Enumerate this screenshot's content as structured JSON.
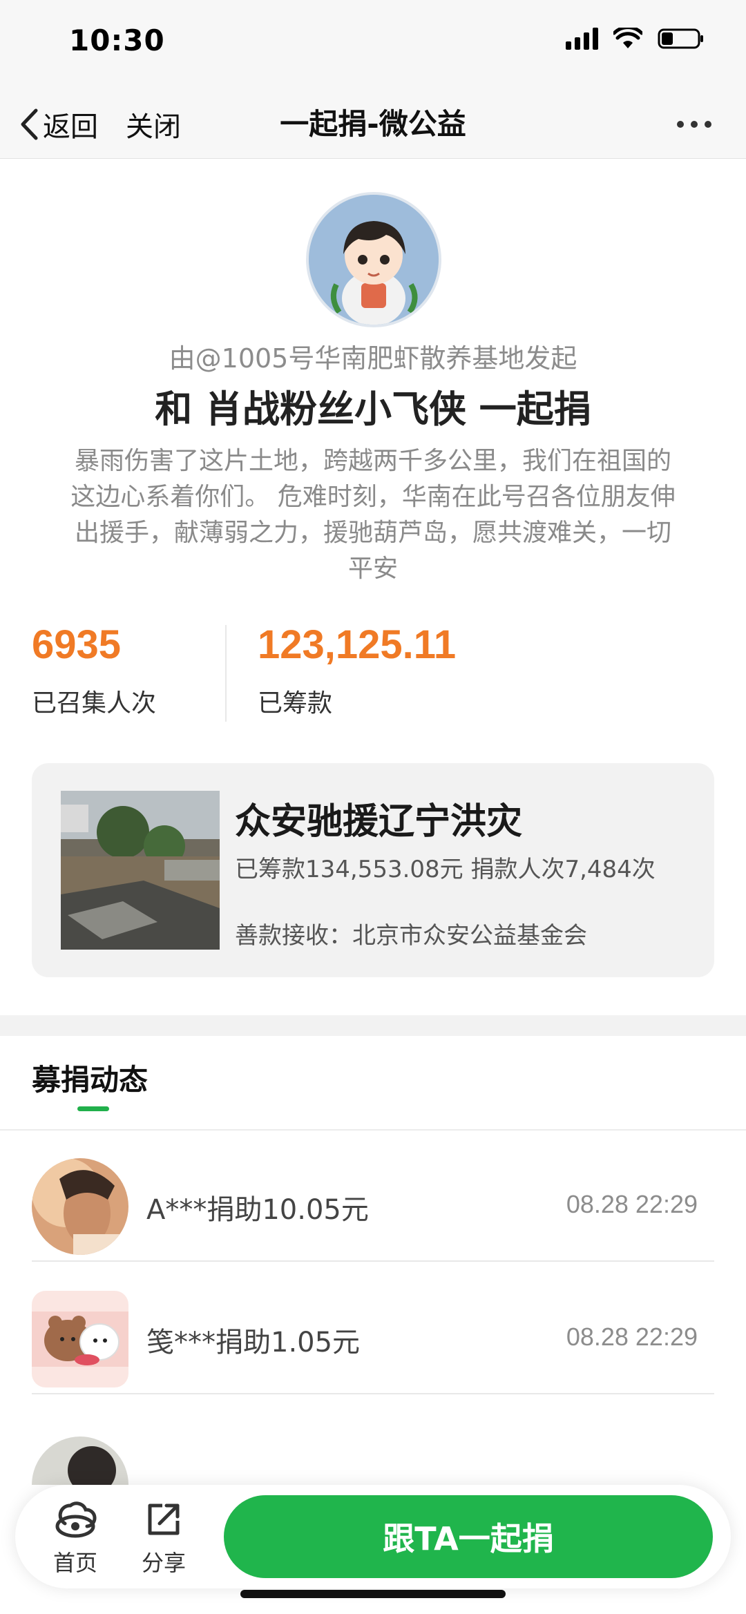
{
  "status_bar": {
    "time": "10:30"
  },
  "nav": {
    "back_label": "返回",
    "close_label": "关闭",
    "title": "一起捐-微公益"
  },
  "header": {
    "initiator": "由@1005号华南肥虾散养基地发起",
    "headline": "和 肖战粉丝小飞侠 一起捐",
    "description": "暴雨伤害了这片土地，跨越两千多公里，我们在祖国的这边心系着你们。 危难时刻，华南在此号召各位朋友伸出援手，献薄弱之力，援驰葫芦岛，愿共渡难关，一切平安"
  },
  "stats": {
    "participants_value": "6935",
    "participants_label": "已召集人次",
    "raised_value": "123,125.11",
    "raised_label": "已筹款",
    "accent_color": "#f07a25"
  },
  "project": {
    "title": "众安驰援辽宁洪灾",
    "meta": "已筹款134,553.08元  捐款人次7,484次",
    "org": "善款接收：北京市众安公益基金会"
  },
  "activity": {
    "title": "募捐动态",
    "items": [
      {
        "text": "A***捐助10.05元",
        "time": "08.28 22:29"
      },
      {
        "text": "笺***捐助1.05元",
        "time": "08.28 22:29"
      }
    ]
  },
  "bottom_bar": {
    "home_label": "首页",
    "share_label": "分享",
    "cta_label": "跟TA一起捐",
    "cta_color": "#20b54c"
  }
}
